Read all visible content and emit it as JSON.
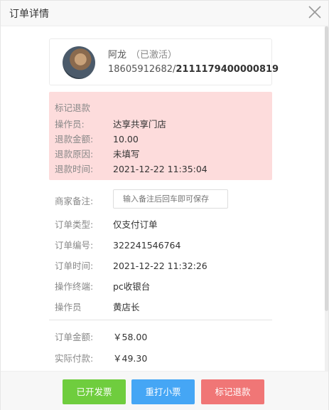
{
  "dialog": {
    "title": "订单详情"
  },
  "user": {
    "name": "阿龙",
    "status": "（已激活）",
    "phone": "18605912682/",
    "card_no": "2111179400000819"
  },
  "refund": {
    "title": "标记退款",
    "rows": [
      {
        "label": "操作员:",
        "value": "达享共享门店"
      },
      {
        "label": "退款金额:",
        "value": "10.00"
      },
      {
        "label": "退款原因:",
        "value": "未填写"
      },
      {
        "label": "退款时间:",
        "value": "2021-12-22 11:35:04"
      }
    ]
  },
  "remark": {
    "label": "商家备注:",
    "placeholder": "输入备注后回车即可保存"
  },
  "details": [
    {
      "label": "订单类型:",
      "value": "仅支付订单"
    },
    {
      "label": "订单编号:",
      "value": "322241546764"
    },
    {
      "label": "订单时间:",
      "value": "2021-12-22 11:32:26"
    },
    {
      "label": "操作终端:",
      "value": "pc收银台"
    },
    {
      "label": "操作员",
      "value": "黄店长"
    }
  ],
  "amounts": [
    {
      "label": "订单金额:",
      "value": "￥58.00"
    },
    {
      "label": "实际付款:",
      "value": "￥49.30"
    }
  ],
  "footer": {
    "invoice": "已开发票",
    "reprint": "重打小票",
    "mark_refund": "标记退款"
  }
}
